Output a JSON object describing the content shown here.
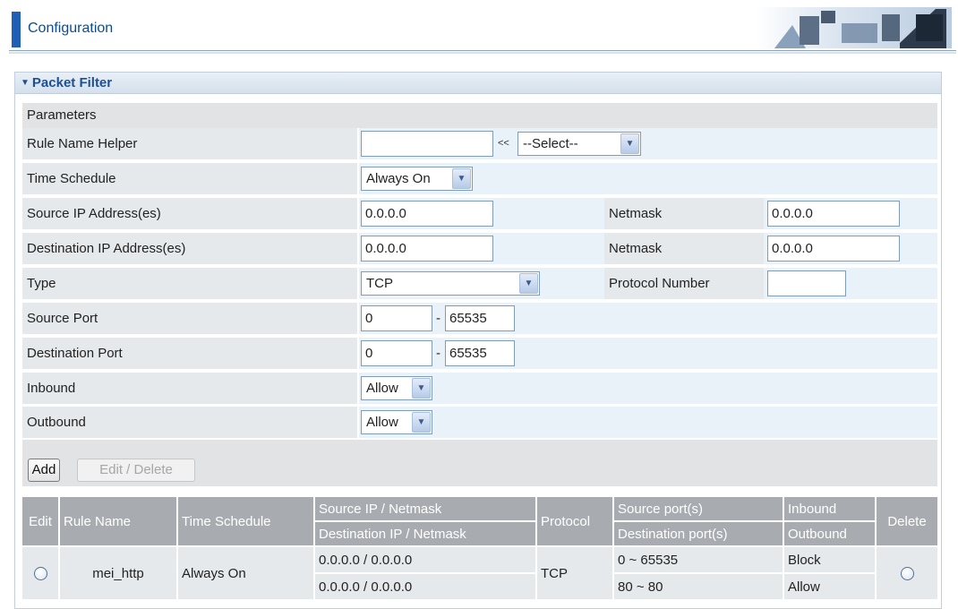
{
  "header": {
    "title": "Configuration"
  },
  "panel": {
    "title": "Packet Filter"
  },
  "params": {
    "section": "Parameters",
    "rule_name_label": "Rule Name  Helper",
    "rule_name_value": "",
    "helper_sep": "<<",
    "helper_select": "--Select--",
    "time_schedule_label": "Time Schedule",
    "time_schedule_value": "Always On",
    "source_ip_label": "Source IP Address(es)",
    "source_ip_value": "0.0.0.0",
    "source_netmask_label": "Netmask",
    "source_netmask_value": "0.0.0.0",
    "dest_ip_label": "Destination IP Address(es)",
    "dest_ip_value": "0.0.0.0",
    "dest_netmask_label": "Netmask",
    "dest_netmask_value": "0.0.0.0",
    "type_label": "Type",
    "type_value": "TCP",
    "protocol_number_label": "Protocol Number",
    "protocol_number_value": "",
    "source_port_label": "Source Port",
    "source_port_from": "0",
    "source_port_to": "65535",
    "dest_port_label": "Destination Port",
    "dest_port_from": "0",
    "dest_port_to": "65535",
    "port_dash": "-",
    "inbound_label": "Inbound",
    "inbound_value": "Allow",
    "outbound_label": "Outbound",
    "outbound_value": "Allow"
  },
  "buttons": {
    "add": "Add",
    "edit_delete": "Edit / Delete"
  },
  "table": {
    "headers": {
      "edit": "Edit",
      "rule_name": "Rule Name",
      "time_schedule": "Time Schedule",
      "source_ip_netmask": "Source IP / Netmask",
      "dest_ip_netmask": "Destination IP / Netmask",
      "protocol": "Protocol",
      "source_ports": "Source port(s)",
      "dest_ports": "Destination port(s)",
      "inbound": "Inbound",
      "outbound": "Outbound",
      "delete": "Delete"
    },
    "rows": [
      {
        "rule_name": "mei_http",
        "time_schedule": "Always On",
        "source_ip": "0.0.0.0 / 0.0.0.0",
        "dest_ip": "0.0.0.0 / 0.0.0.0",
        "protocol": "TCP",
        "source_ports": "0 ~ 65535",
        "dest_ports": "80 ~ 80",
        "inbound": "Block",
        "outbound": "Allow"
      }
    ]
  }
}
